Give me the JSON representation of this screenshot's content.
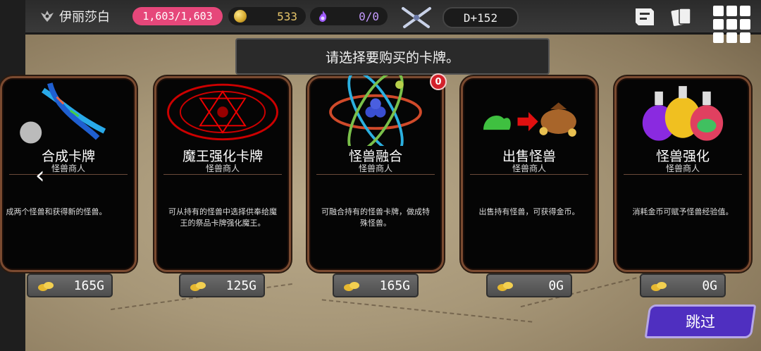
{
  "hud": {
    "player_name": "伊丽莎白",
    "hp": "1,603/1,603",
    "gold": "533",
    "soul": "0/0",
    "day": "D+152"
  },
  "banner": {
    "text": "请选择要购买的卡牌。"
  },
  "cards": [
    {
      "title": "合成卡牌",
      "subtitle": "怪兽商人",
      "description": "成两个怪兽和获得新的怪兽。",
      "price": "165G",
      "art_icon": "dna-icon"
    },
    {
      "title": "魔王强化卡牌",
      "subtitle": "怪兽商人",
      "description": "可从持有的怪兽中选择供奉给魔王的祭品卡牌强化魔王。",
      "price": "125G",
      "art_icon": "magic-circle-icon"
    },
    {
      "title": "怪兽融合",
      "subtitle": "怪兽商人",
      "description": "可融合持有的怪兽卡牌，做成特殊怪兽。",
      "price": "165G",
      "art_icon": "atom-icon",
      "badge": "0"
    },
    {
      "title": "出售怪兽",
      "subtitle": "怪兽商人",
      "description": "出售持有怪兽，可获得金币。",
      "price": "0G",
      "art_icon": "slime-to-money-bag-icon"
    },
    {
      "title": "怪兽强化",
      "subtitle": "怪兽商人",
      "description": "消耗金币可赋予怪兽经验值。",
      "price": "0G",
      "art_icon": "potion-bottles-icon"
    }
  ],
  "skip_button": {
    "label": "跳过"
  },
  "colors": {
    "hp_pill": "#e6477a",
    "skip_button": "#4f2fc0",
    "card_border": "#7a4a30",
    "badge": "#d3202a"
  }
}
